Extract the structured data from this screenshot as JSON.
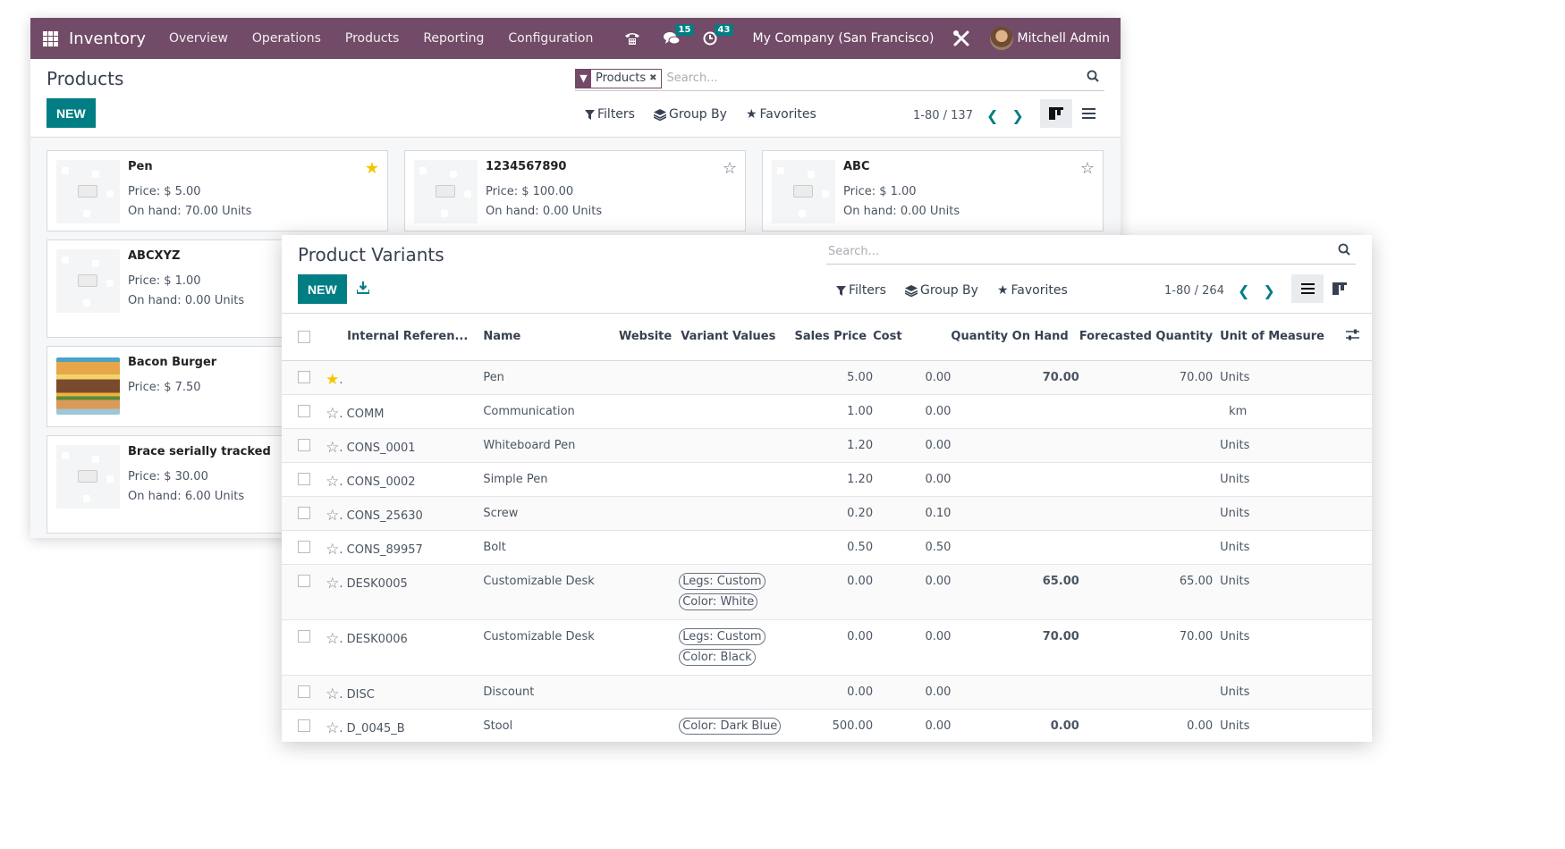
{
  "navbar": {
    "app_name": "Inventory",
    "menu": [
      "Overview",
      "Operations",
      "Products",
      "Reporting",
      "Configuration"
    ],
    "messages_count": "15",
    "activities_count": "43",
    "company": "My Company (San Francisco)",
    "user": "Mitchell Admin",
    "brand_color": "#714b67",
    "accent_color": "#017e84"
  },
  "products": {
    "title": "Products",
    "new_label": "NEW",
    "facet_label": "Products",
    "search_placeholder": "Search...",
    "filters_label": "Filters",
    "groupby_label": "Group By",
    "favorites_label": "Favorites",
    "pager": "1-80 / 137",
    "cards": [
      {
        "name": "Pen",
        "price": "Price: $ 5.00",
        "onhand": "On hand: 70.00 Units",
        "favorite": true
      },
      {
        "name": "1234567890",
        "price": "Price: $ 100.00",
        "onhand": "On hand: 0.00 Units",
        "favorite": false
      },
      {
        "name": "ABC",
        "price": "Price: $ 1.00",
        "onhand": "On hand: 0.00 Units",
        "favorite": false
      },
      {
        "name": "ABCXYZ",
        "price": "Price: $ 1.00",
        "onhand": "On hand: 0.00 Units",
        "favorite": false
      },
      {
        "name": "Bacon Burger",
        "price": "Price: $ 7.50",
        "onhand": "",
        "favorite": false
      },
      {
        "name": "Brace serially tracked",
        "price": "Price: $ 30.00",
        "onhand": "On hand: 6.00 Units",
        "favorite": false
      }
    ]
  },
  "variants": {
    "title": "Product Variants",
    "new_label": "NEW",
    "search_placeholder": "Search...",
    "filters_label": "Filters",
    "groupby_label": "Group By",
    "favorites_label": "Favorites",
    "pager": "1-80 / 264",
    "columns": [
      "Internal Referen...",
      "Name",
      "Website",
      "Variant Values",
      "Sales Price",
      "Cost",
      "Quantity On Hand",
      "Forecasted Quantity",
      "Unit of Measure"
    ],
    "rows": [
      {
        "ref": ".",
        "name": "Pen",
        "tags": [],
        "price": "5.00",
        "cost": "0.00",
        "onhand": "70.00",
        "forecast": "70.00",
        "uom": "Units",
        "favorite": true,
        "warn": false
      },
      {
        "ref": ". COMM",
        "name": "Communication",
        "tags": [],
        "price": "1.00",
        "cost": "0.00",
        "onhand": "",
        "forecast": "",
        "uom": "km",
        "favorite": false,
        "warn": false
      },
      {
        "ref": ". CONS_0001",
        "name": "Whiteboard Pen",
        "tags": [],
        "price": "1.20",
        "cost": "0.00",
        "onhand": "",
        "forecast": "",
        "uom": "Units",
        "favorite": false,
        "warn": false
      },
      {
        "ref": ". CONS_0002",
        "name": "Simple Pen",
        "tags": [],
        "price": "1.20",
        "cost": "0.00",
        "onhand": "",
        "forecast": "",
        "uom": "Units",
        "favorite": false,
        "warn": false
      },
      {
        "ref": ". CONS_25630",
        "name": "Screw",
        "tags": [],
        "price": "0.20",
        "cost": "0.10",
        "onhand": "",
        "forecast": "",
        "uom": "Units",
        "favorite": false,
        "warn": false
      },
      {
        "ref": ". CONS_89957",
        "name": "Bolt",
        "tags": [],
        "price": "0.50",
        "cost": "0.50",
        "onhand": "",
        "forecast": "",
        "uom": "Units",
        "favorite": false,
        "warn": false
      },
      {
        "ref": ". DESK0005",
        "name": "Customizable Desk",
        "tags": [
          "Legs: Custom",
          "Color: White"
        ],
        "price": "0.00",
        "cost": "0.00",
        "onhand": "65.00",
        "forecast": "65.00",
        "uom": "Units",
        "favorite": false,
        "warn": false
      },
      {
        "ref": ". DESK0006",
        "name": "Customizable Desk",
        "tags": [
          "Legs: Custom",
          "Color: Black"
        ],
        "price": "0.00",
        "cost": "0.00",
        "onhand": "70.00",
        "forecast": "70.00",
        "uom": "Units",
        "favorite": false,
        "warn": false
      },
      {
        "ref": ". DISC",
        "name": "Discount",
        "tags": [],
        "price": "0.00",
        "cost": "0.00",
        "onhand": "",
        "forecast": "",
        "uom": "Units",
        "favorite": false,
        "warn": false
      },
      {
        "ref": ". D_0045_B",
        "name": "Stool",
        "tags": [
          "Color: Dark Blue"
        ],
        "price": "500.00",
        "cost": "0.00",
        "onhand": "0.00",
        "forecast": "0.00",
        "uom": "Units",
        "favorite": false,
        "warn": true
      }
    ]
  }
}
